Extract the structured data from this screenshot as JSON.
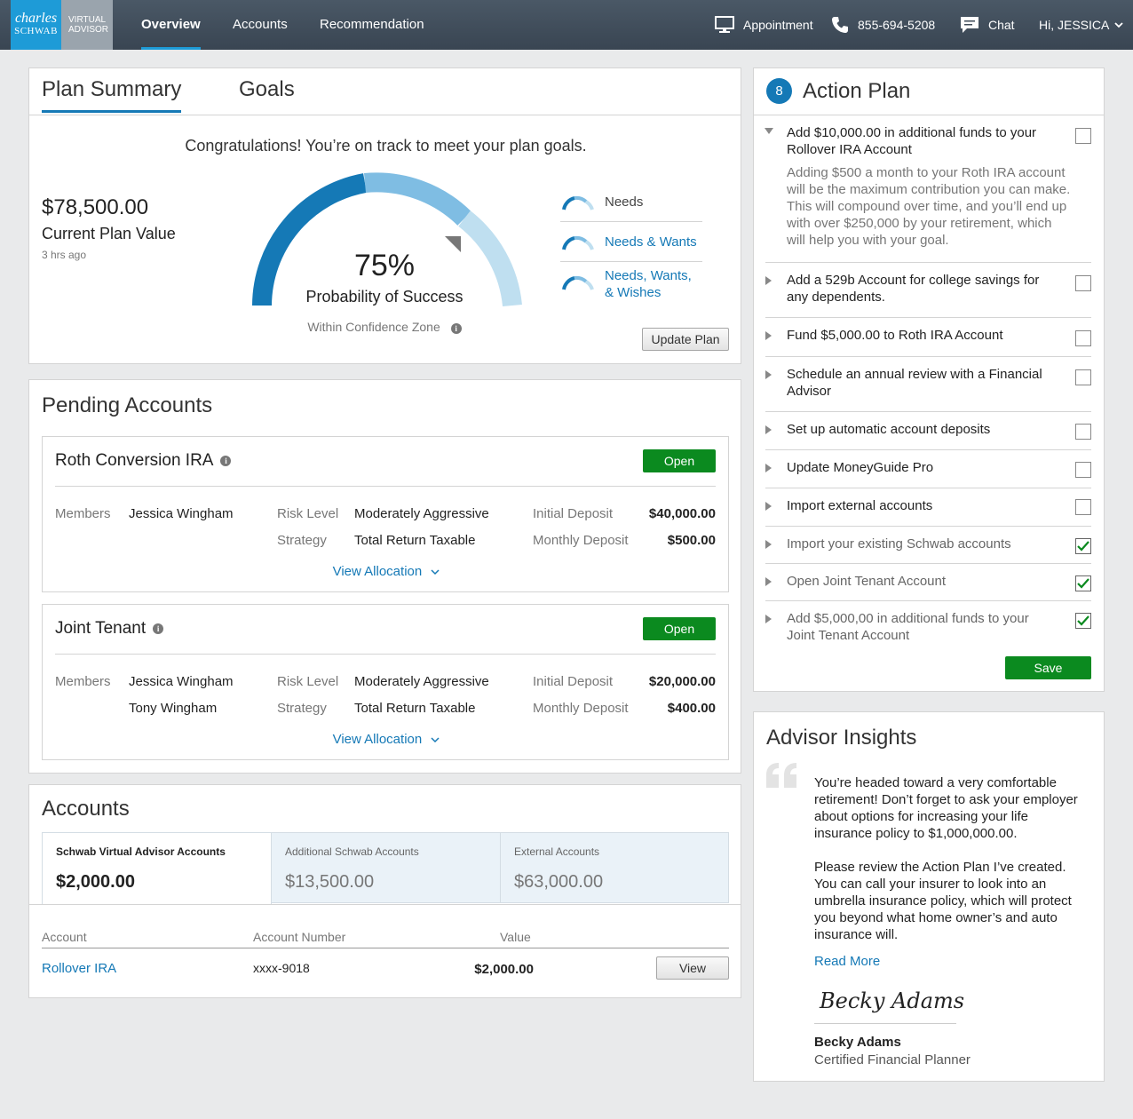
{
  "header": {
    "logo_line1": "charles",
    "logo_line2": "SCHWAB",
    "logo_sub1": "VIRTUAL",
    "logo_sub2": "ADVISOR",
    "tabs": [
      {
        "label": "Overview",
        "active": true
      },
      {
        "label": "Accounts",
        "active": false
      },
      {
        "label": "Recommendation",
        "active": false
      }
    ],
    "appointment_label": "Appointment",
    "phone": "855-694-5208",
    "chat_label": "Chat",
    "user_greeting": "Hi, JESSICA"
  },
  "plan_summary": {
    "tabs": [
      "Plan Summary",
      "Goals"
    ],
    "message": "Congratulations! You’re on track to meet your plan goals.",
    "plan_value": "$78,500.00",
    "plan_value_label": "Current Plan Value",
    "updated": "3 hrs ago",
    "probability": "75%",
    "probability_label": "Probability of Success",
    "confidence_label": "Within Confidence Zone",
    "probability_fraction": 0.75,
    "legend": [
      {
        "label": "Needs",
        "color": "#333333"
      },
      {
        "label": "Needs & Wants",
        "color": "#1579b6"
      },
      {
        "label": "Needs, Wants,",
        "label2": "& Wishes",
        "color": "#1579b6"
      }
    ],
    "update_button": "Update Plan",
    "colors": {
      "needs": "#1579b6",
      "wants": "#7fbde3",
      "wishes": "#bfdff0"
    }
  },
  "pending": {
    "title": "Pending Accounts",
    "labels": {
      "members": "Members",
      "risk": "Risk Level",
      "strategy": "Strategy",
      "initial": "Initial Deposit",
      "monthly": "Monthly Deposit",
      "view": "View Allocation",
      "open": "Open"
    },
    "accounts": [
      {
        "name": "Roth Conversion IRA",
        "member1": "Jessica Wingham",
        "member2": "",
        "risk": "Moderately Aggressive",
        "strategy": "Total Return Taxable",
        "initial": "$40,000.00",
        "monthly": "$500.00"
      },
      {
        "name": "Joint Tenant",
        "member1": "Jessica Wingham",
        "member2": "Tony Wingham",
        "risk": "Moderately Aggressive",
        "strategy": "Total Return Taxable",
        "initial": "$20,000.00",
        "monthly": "$400.00"
      }
    ]
  },
  "accounts": {
    "title": "Accounts",
    "tiles": [
      {
        "label": "Schwab Virtual Advisor Accounts",
        "value": "$2,000.00"
      },
      {
        "label": "Additional Schwab Accounts",
        "value": "$13,500.00"
      },
      {
        "label": "External Accounts",
        "value": "$63,000.00"
      }
    ],
    "columns": [
      "Account",
      "Account Number",
      "Value"
    ],
    "rows": [
      {
        "account": "Rollover IRA",
        "number": "xxxx-9018",
        "value": "$2,000.00",
        "action": "View"
      }
    ]
  },
  "action_plan": {
    "count": "8",
    "title": "Action Plan",
    "items": [
      {
        "text": "Add $10,000.00 in additional funds to your Rollover IRA Account",
        "desc": "Adding $500 a month to your Roth IRA account will be the maximum contribution you can make. This will compound over time, and you’ll end up with over $250,000 by your retirement, which will help you with your goal.",
        "checked": false
      },
      {
        "text": "Add a 529b Account for college savings for any dependents.",
        "checked": false
      },
      {
        "text": "Fund $5,000.00 to Roth IRA Account",
        "checked": false
      },
      {
        "text": "Schedule an annual review with a Financial Advisor",
        "checked": false
      },
      {
        "text": "Set up automatic account deposits",
        "checked": false
      },
      {
        "text": "Update MoneyGuide Pro",
        "checked": false
      },
      {
        "text": "Import external accounts",
        "checked": false
      },
      {
        "text": "Import your existing Schwab accounts",
        "checked": true
      },
      {
        "text": "Open Joint Tenant Account",
        "checked": true
      },
      {
        "text": "Add $5,000,00 in additional funds to your Joint Tenant Account",
        "checked": true
      }
    ],
    "save_button": "Save"
  },
  "insights": {
    "title": "Advisor Insights",
    "para1": "You’re headed toward a very comfortable retirement! Don’t forget to ask your employer about options for increasing your life insurance policy to $1,000,000.00.",
    "para2": "Please review the Action Plan I’ve created. You can call your insurer to look into an umbrella insurance policy, which will protect you beyond what home owner’s and auto insurance will.",
    "read_more": "Read More",
    "signature": "Becky Adams",
    "advisor_name": "Becky Adams",
    "advisor_title": "Certified Financial Planner"
  }
}
